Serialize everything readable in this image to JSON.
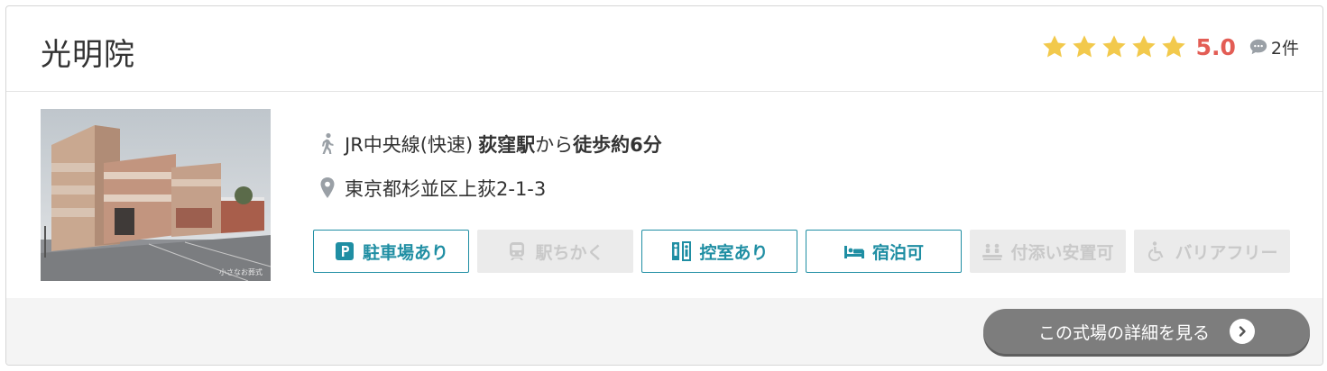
{
  "listing": {
    "name": "光明院",
    "rating": {
      "stars": 5,
      "score": "5.0",
      "review_count": "2件"
    },
    "access": {
      "line": "JR中央線(快速)",
      "station": "荻窪駅",
      "from": "から",
      "walk": "徒歩約6分"
    },
    "address": "東京都杉並区上荻2-1-3",
    "photo_watermark": "小さなお葬式",
    "features": [
      {
        "label": "駐車場あり",
        "icon": "parking-icon",
        "available": true
      },
      {
        "label": "駅ちかく",
        "icon": "train-icon",
        "available": false
      },
      {
        "label": "控室あり",
        "icon": "waiting-room-icon",
        "available": true
      },
      {
        "label": "宿泊可",
        "icon": "bed-icon",
        "available": true
      },
      {
        "label": "付添い安置可",
        "icon": "attendance-icon",
        "available": false
      },
      {
        "label": "バリアフリー",
        "icon": "wheelchair-icon",
        "available": false
      }
    ],
    "detail_button": "この式場の詳細を見る"
  },
  "colors": {
    "accent": "#1f8ea3",
    "score": "#e35d55",
    "star": "#f2c94c",
    "button": "#7d7d7d",
    "disabled_bg": "#ebebeb"
  }
}
